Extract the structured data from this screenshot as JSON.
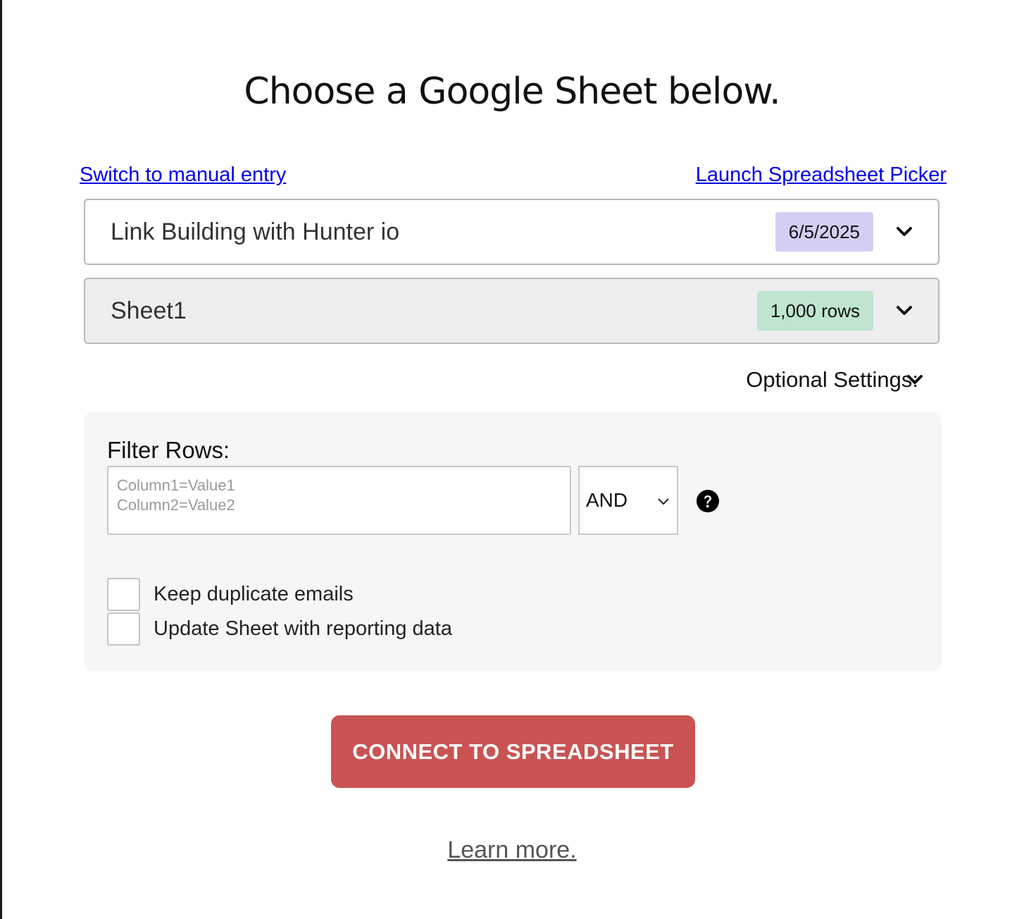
{
  "title": "Choose a Google Sheet below.",
  "links": {
    "manual_entry": "Switch to manual entry",
    "picker": "Launch Spreadsheet Picker"
  },
  "spreadsheet": {
    "name": "Link Building with Hunter io",
    "date_badge": "6/5/2025",
    "badge_color": "#d6cdf5"
  },
  "sheet": {
    "name": "Sheet1",
    "rows_badge": "1,000 rows",
    "badge_color": "#bfe5cf"
  },
  "optional_settings": {
    "label": "Optional Settings:"
  },
  "filter": {
    "label": "Filter Rows:",
    "placeholder": "Column1=Value1\nColumn2=Value2",
    "value": "",
    "operator": "AND",
    "help_icon": "question-circle-icon"
  },
  "checkboxes": [
    {
      "label": "Keep duplicate emails",
      "checked": false
    },
    {
      "label": "Update Sheet with reporting data",
      "checked": false
    }
  ],
  "connect_button": {
    "label": "CONNECT TO SPREADSHEET",
    "color": "#c95353"
  },
  "learn_more": "Learn more."
}
